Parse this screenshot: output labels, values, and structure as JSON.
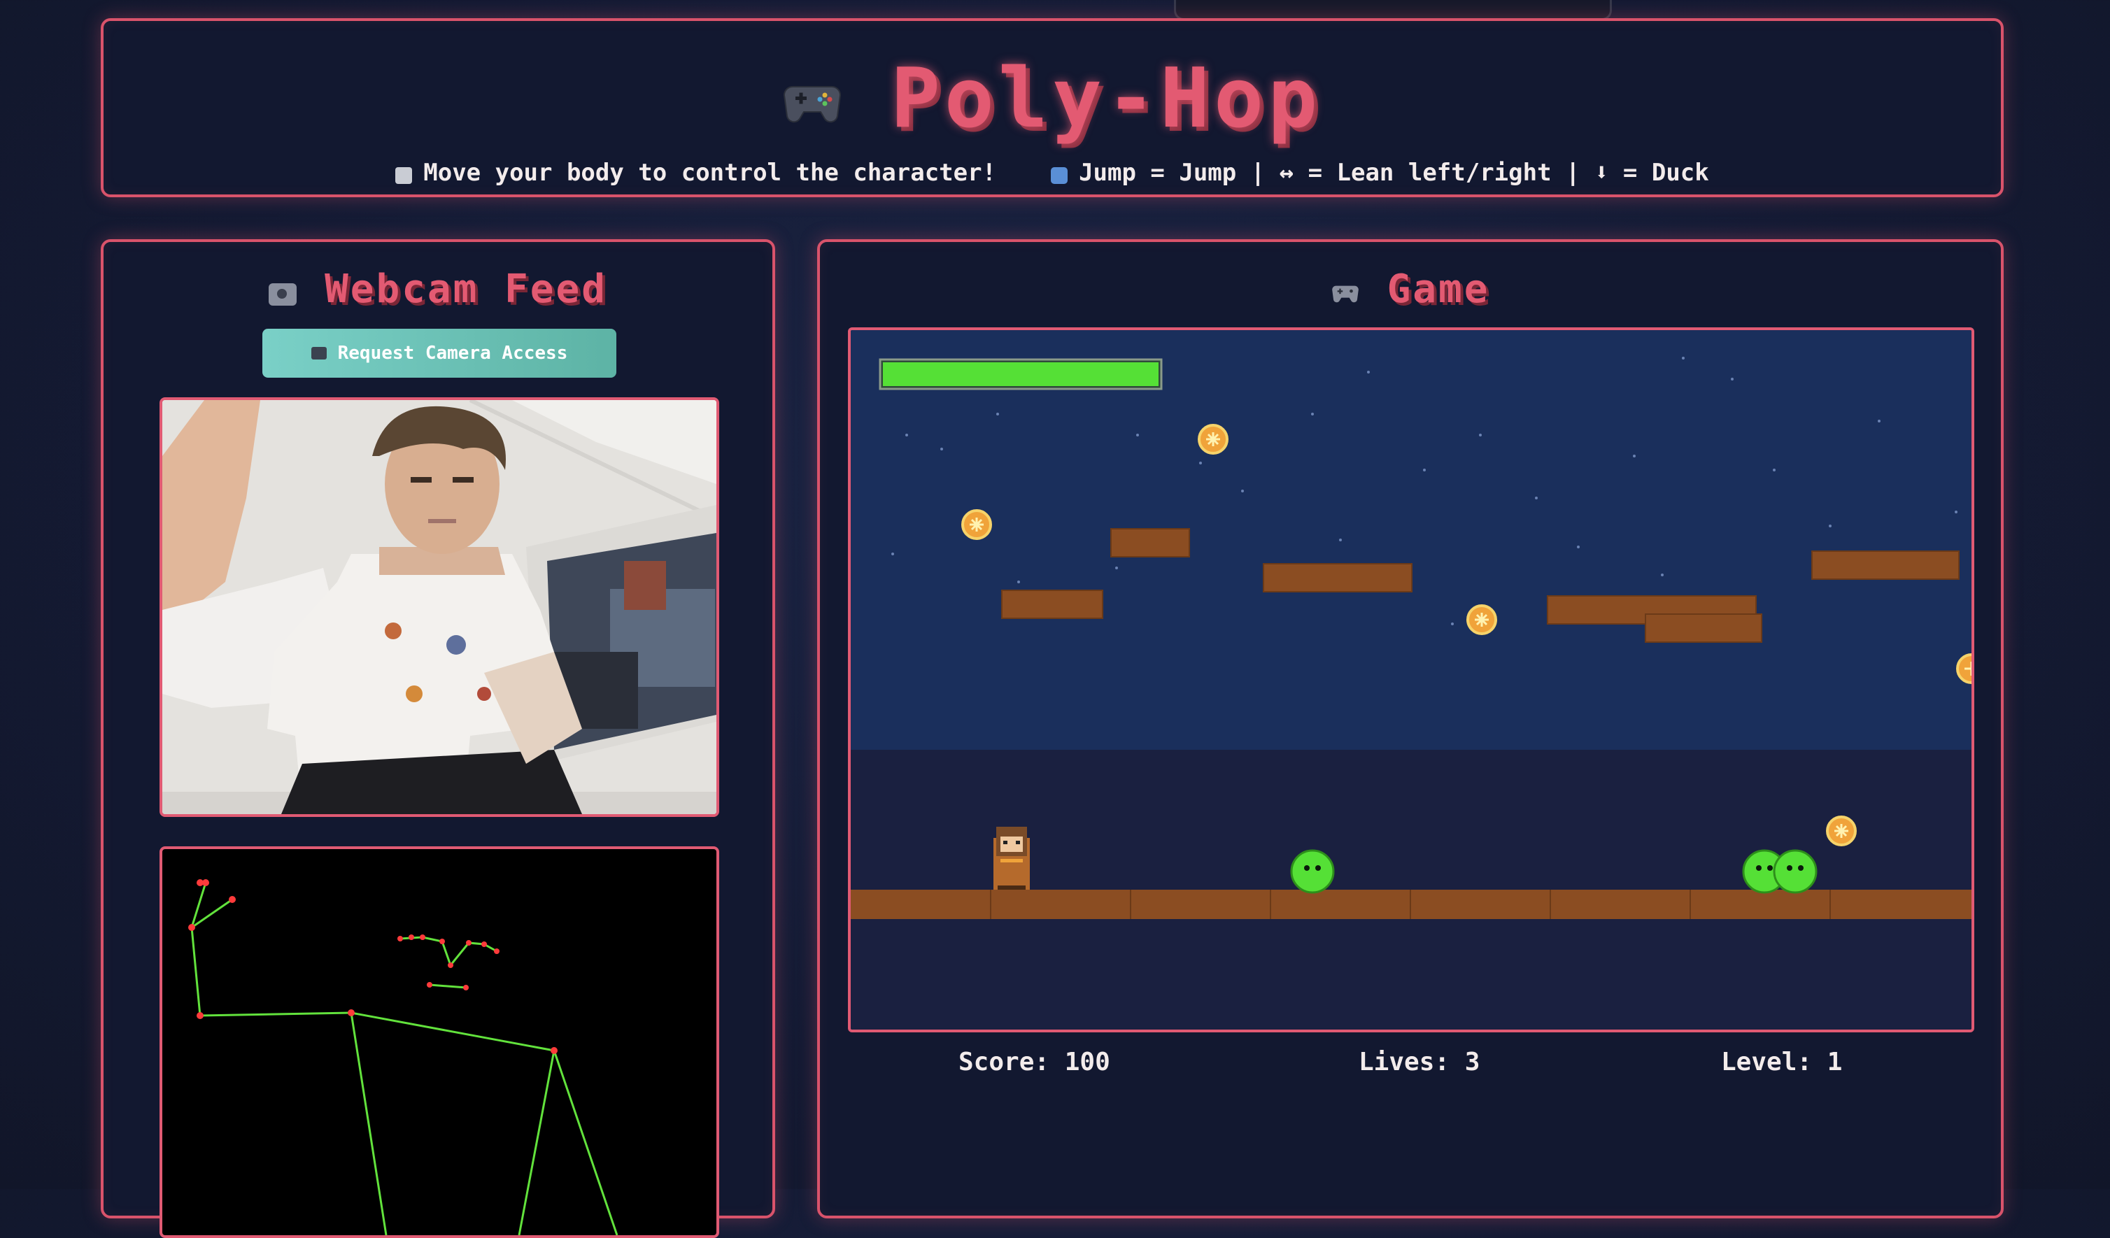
{
  "header": {
    "title": "Poly-Hop",
    "instruction": "Move your body to control the character!",
    "controls": "Jump = Jump | ↔ = Lean left/right | ⬇ = Duck"
  },
  "webcam": {
    "title": "Webcam Feed",
    "request_button": "Request Camera Access"
  },
  "game": {
    "title": "Game",
    "health_bar_fraction": 1.0,
    "stats": {
      "score": "Score: 100",
      "lives": "Lives: 3",
      "level": "Level: 1"
    }
  },
  "colors": {
    "accent": "#e35a72",
    "button": "#6cc3b8",
    "health": "#55e036",
    "pose_line": "#62e23c",
    "pose_joint": "#ff3b3b"
  }
}
